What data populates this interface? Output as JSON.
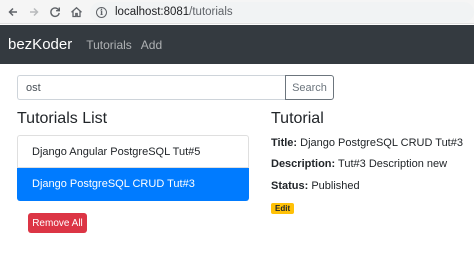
{
  "browser": {
    "url_host": "localhost:8081",
    "url_path": "/tutorials",
    "icons": {
      "back": "arrow-left-icon",
      "forward": "arrow-right-icon",
      "reload": "reload-icon",
      "home": "home-icon",
      "site_info": "info-icon"
    }
  },
  "navbar": {
    "brand": "bezKoder",
    "links": [
      "Tutorials",
      "Add"
    ],
    "background_color": "#343a40"
  },
  "search": {
    "value": "ost",
    "button_label": "Search"
  },
  "tutorials_list": {
    "heading": "Tutorials List",
    "items": [
      {
        "title": "Django Angular PostgreSQL Tut#5",
        "active": false
      },
      {
        "title": "Django PostgreSQL CRUD Tut#3",
        "active": true
      }
    ],
    "remove_all_label": "Remove All",
    "active_color": "#007bff",
    "remove_all_color": "#dc3545"
  },
  "tutorial_detail": {
    "heading": "Tutorial",
    "title_label": "Title:",
    "title_value": "Django PostgreSQL CRUD Tut#3",
    "description_label": "Description:",
    "description_value": "Tut#3 Description new",
    "status_label": "Status:",
    "status_value": "Published",
    "edit_label": "Edit",
    "edit_color": "#ffc107"
  }
}
